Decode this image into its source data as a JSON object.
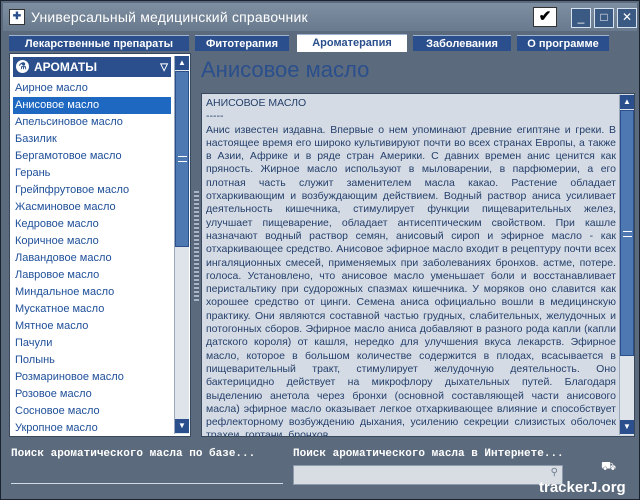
{
  "window": {
    "title": "Универсальный медицинский справочник",
    "check_glyph": "✔",
    "min_glyph": "_",
    "max_glyph": "□",
    "close_glyph": "✕"
  },
  "tabs": [
    {
      "label": "Лекарственные препараты",
      "active": false
    },
    {
      "label": "Фитотерапия",
      "active": false
    },
    {
      "label": "Ароматерапия",
      "active": true
    },
    {
      "label": "Заболевания",
      "active": false
    },
    {
      "label": "О программе",
      "active": false
    }
  ],
  "sidebar": {
    "header": "АРОМАТЫ",
    "items": [
      "Аирное масло",
      "Анисовое масло",
      "Апельсиновое масло",
      "Базилик",
      "Бергамотовое масло",
      "Герань",
      "Грейпфрутовое масло",
      "Жасминовое масло",
      "Кедровое масло",
      "Коричное масло",
      "Лавандовое масло",
      "Лавровое масло",
      "Миндальное масло",
      "Мускатное масло",
      "Мятное масло",
      "Пачули",
      "Полынь",
      "Розмариновое масло",
      "Розовое масло",
      "Сосновое масло",
      "Укропное масло"
    ],
    "selected_index": 1
  },
  "article": {
    "title": "Анисовое масло",
    "heading": "АНИСОВОЕ МАСЛО",
    "dash": "-----",
    "body": "Анис известен издавна. Впервые о нем упоминают древние египтяне и греки. В настоящее время его широко культивируют почти во всех странах Европы, а также в Азии, Африке и в ряде стран Америки. С давних времен анис ценится как пряность. Жирное масло используют в мыловарении, в парфюмерии, а его плотная часть служит заменителем масла какао. Растение обладает отхаркивающим и возбуждающим действием. Водный раствор аниса усиливает деятельность кишечника, стимулирует функции пищеварительных желез, улучшает пищеварение, обладает антисептическим свойством. При кашле назначают водный раствор семян, анисовый сироп и эфирное масло - как отхаркивающее средство. Анисовое эфирное масло входит в рецептуру почти всех ингаляционных смесей, применяемых при заболеваниях бронхов. астме, потере. голоса. Установлено, что анисовое масло уменьшает боли и восстанавливает перистальтику при судорожных спазмах кишечника. У моряков оно славится как хорошее средство от цинги. Семена аниса официально вошли в медицинскую практику. Они являются составной частью грудных, слабительных, желудочных и потогонных сборов. Эфирное масло аниса добавляют в разного рода капли (капли датского короля) от кашля, нередко для улучшения вкуса лекарств. Эфирное масло, которое в большом количестве содержится в плодах, всасывается в пищеварительный тракт, стимулирует желудочную деятельность. Оно бактерицидно действует на микрофлору дыхательных путей. Благодаря выделению анетола через бронхи (основной составляющей части анисового масла) эфирное масло оказывает легкое отхаркивающее влияние и способствует рефлекторному возбуждению дыхания, усилению секреции слизистых оболочек трахеи, гортани, бронхов."
  },
  "bottom": {
    "search_db_label": "Поиск ароматического масла по базе...",
    "search_web_label": "Поиск ароматического масла в Интернете...",
    "search_web_value": ""
  },
  "watermark": "trackerJ.org",
  "colors": {
    "accent": "#2a4f8c",
    "frame": "#5b6a7c",
    "selection": "#1e68c2",
    "link_text": "#1e4f99"
  }
}
